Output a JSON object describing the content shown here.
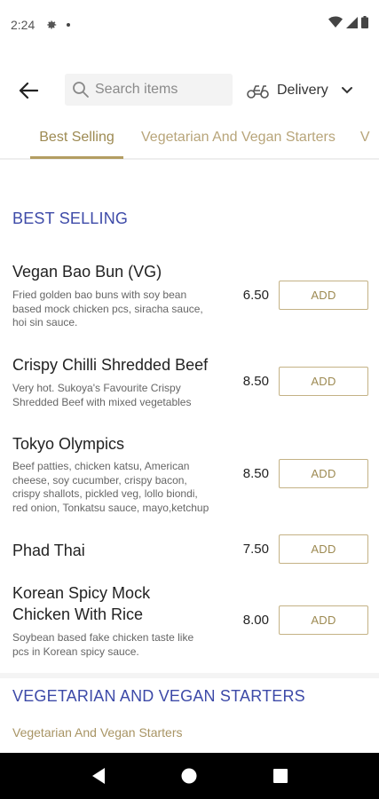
{
  "status_bar": {
    "time": "2:24"
  },
  "header": {
    "search_placeholder": "Search items",
    "delivery_label": "Delivery"
  },
  "tabs": [
    {
      "label": "Best Selling",
      "active": true
    },
    {
      "label": "Vegetarian And Vegan Starters",
      "active": false
    },
    {
      "label": "V",
      "active": false
    }
  ],
  "sections": {
    "best_selling": {
      "title": "BEST SELLING",
      "items": [
        {
          "name": "Vegan Bao Bun (VG)",
          "desc_lines": [
            "Fried golden bao buns with soy bean",
            "based mock chicken pcs, siracha sauce,",
            "hoi sin sauce."
          ],
          "price": "6.50",
          "add_label": "ADD"
        },
        {
          "name": "Crispy Chilli Shredded Beef",
          "desc_lines": [
            "Very hot. Sukoya's Favourite Crispy",
            "Shredded Beef with mixed vegetables"
          ],
          "price": "8.50",
          "add_label": "ADD"
        },
        {
          "name": "Tokyo Olympics",
          "desc_lines": [
            "Beef patties, chicken katsu, American",
            "cheese, soy cucumber, crispy bacon,",
            "crispy shallots, pickled veg, lollo biondi,",
            "red onion, Tonkatsu sauce, mayo,ketchup"
          ],
          "price": "8.50",
          "add_label": "ADD"
        },
        {
          "name": "Phad Thai",
          "desc_lines": [],
          "price": "7.50",
          "add_label": "ADD"
        },
        {
          "name_lines": [
            "Korean Spicy Mock",
            "Chicken With Rice"
          ],
          "desc_lines": [
            "Soybean based fake chicken taste like",
            "pcs in Korean spicy sauce."
          ],
          "price": "8.00",
          "add_label": "ADD"
        }
      ]
    },
    "veg_starters": {
      "title": "VEGETARIAN AND VEGAN STARTERS",
      "subtitle": "Vegetarian And Vegan Starters"
    }
  },
  "colors": {
    "accent": "#b39d62",
    "section_title": "#3d4aa8",
    "nav_bar": "#000000"
  },
  "icons": [
    "gear-icon",
    "dot-icon",
    "wifi-icon",
    "signal-icon",
    "battery-icon",
    "back-arrow-icon",
    "search-icon",
    "scooter-icon",
    "chevron-down-icon",
    "nav-back-icon",
    "nav-home-icon",
    "nav-recents-icon"
  ]
}
